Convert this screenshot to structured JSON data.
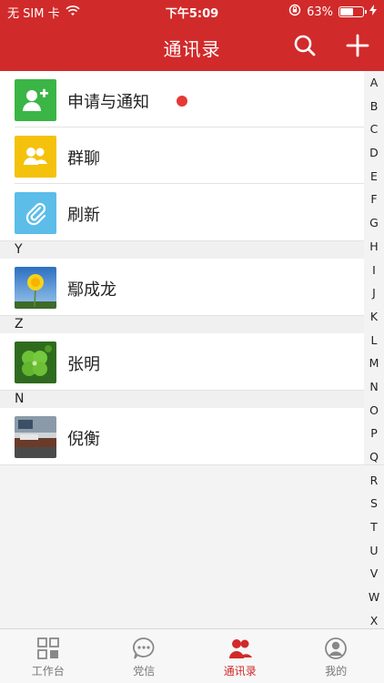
{
  "status_bar": {
    "carrier": "无 SIM 卡",
    "time": "下午5:09",
    "battery_percent_text": "63%",
    "battery_level": 0.63
  },
  "nav": {
    "title": "通讯录",
    "search_icon": "search-icon",
    "add_icon": "plus-icon"
  },
  "entries": [
    {
      "label": "申请与通知",
      "icon": "add-user-icon",
      "color": "#3bb545",
      "unread": true
    },
    {
      "label": "群聊",
      "icon": "group-icon",
      "color": "#f4c20d"
    },
    {
      "label": "刷新",
      "icon": "paperclip-icon",
      "color": "#5bbde8"
    }
  ],
  "sections": [
    {
      "letter": "Y",
      "contact": "鄢成龙",
      "avatar": "dandelion-photo"
    },
    {
      "letter": "Z",
      "contact": "张明",
      "avatar": "clover-photo"
    },
    {
      "letter": "N",
      "contact": "倪衡",
      "avatar": "room-photo"
    }
  ],
  "index_letters": [
    "A",
    "B",
    "C",
    "D",
    "E",
    "F",
    "G",
    "H",
    "I",
    "J",
    "K",
    "L",
    "M",
    "N",
    "O",
    "P",
    "Q",
    "R",
    "S",
    "T",
    "U",
    "V",
    "W",
    "X"
  ],
  "tabs": [
    {
      "label": "工作台",
      "icon": "workbench-icon",
      "active": false
    },
    {
      "label": "党信",
      "icon": "chat-bubble-icon",
      "active": false
    },
    {
      "label": "通讯录",
      "icon": "contacts-icon",
      "active": true
    },
    {
      "label": "我的",
      "icon": "profile-icon",
      "active": false
    }
  ],
  "colors": {
    "primary": "#d12a2a",
    "background": "#f3f3f3"
  }
}
